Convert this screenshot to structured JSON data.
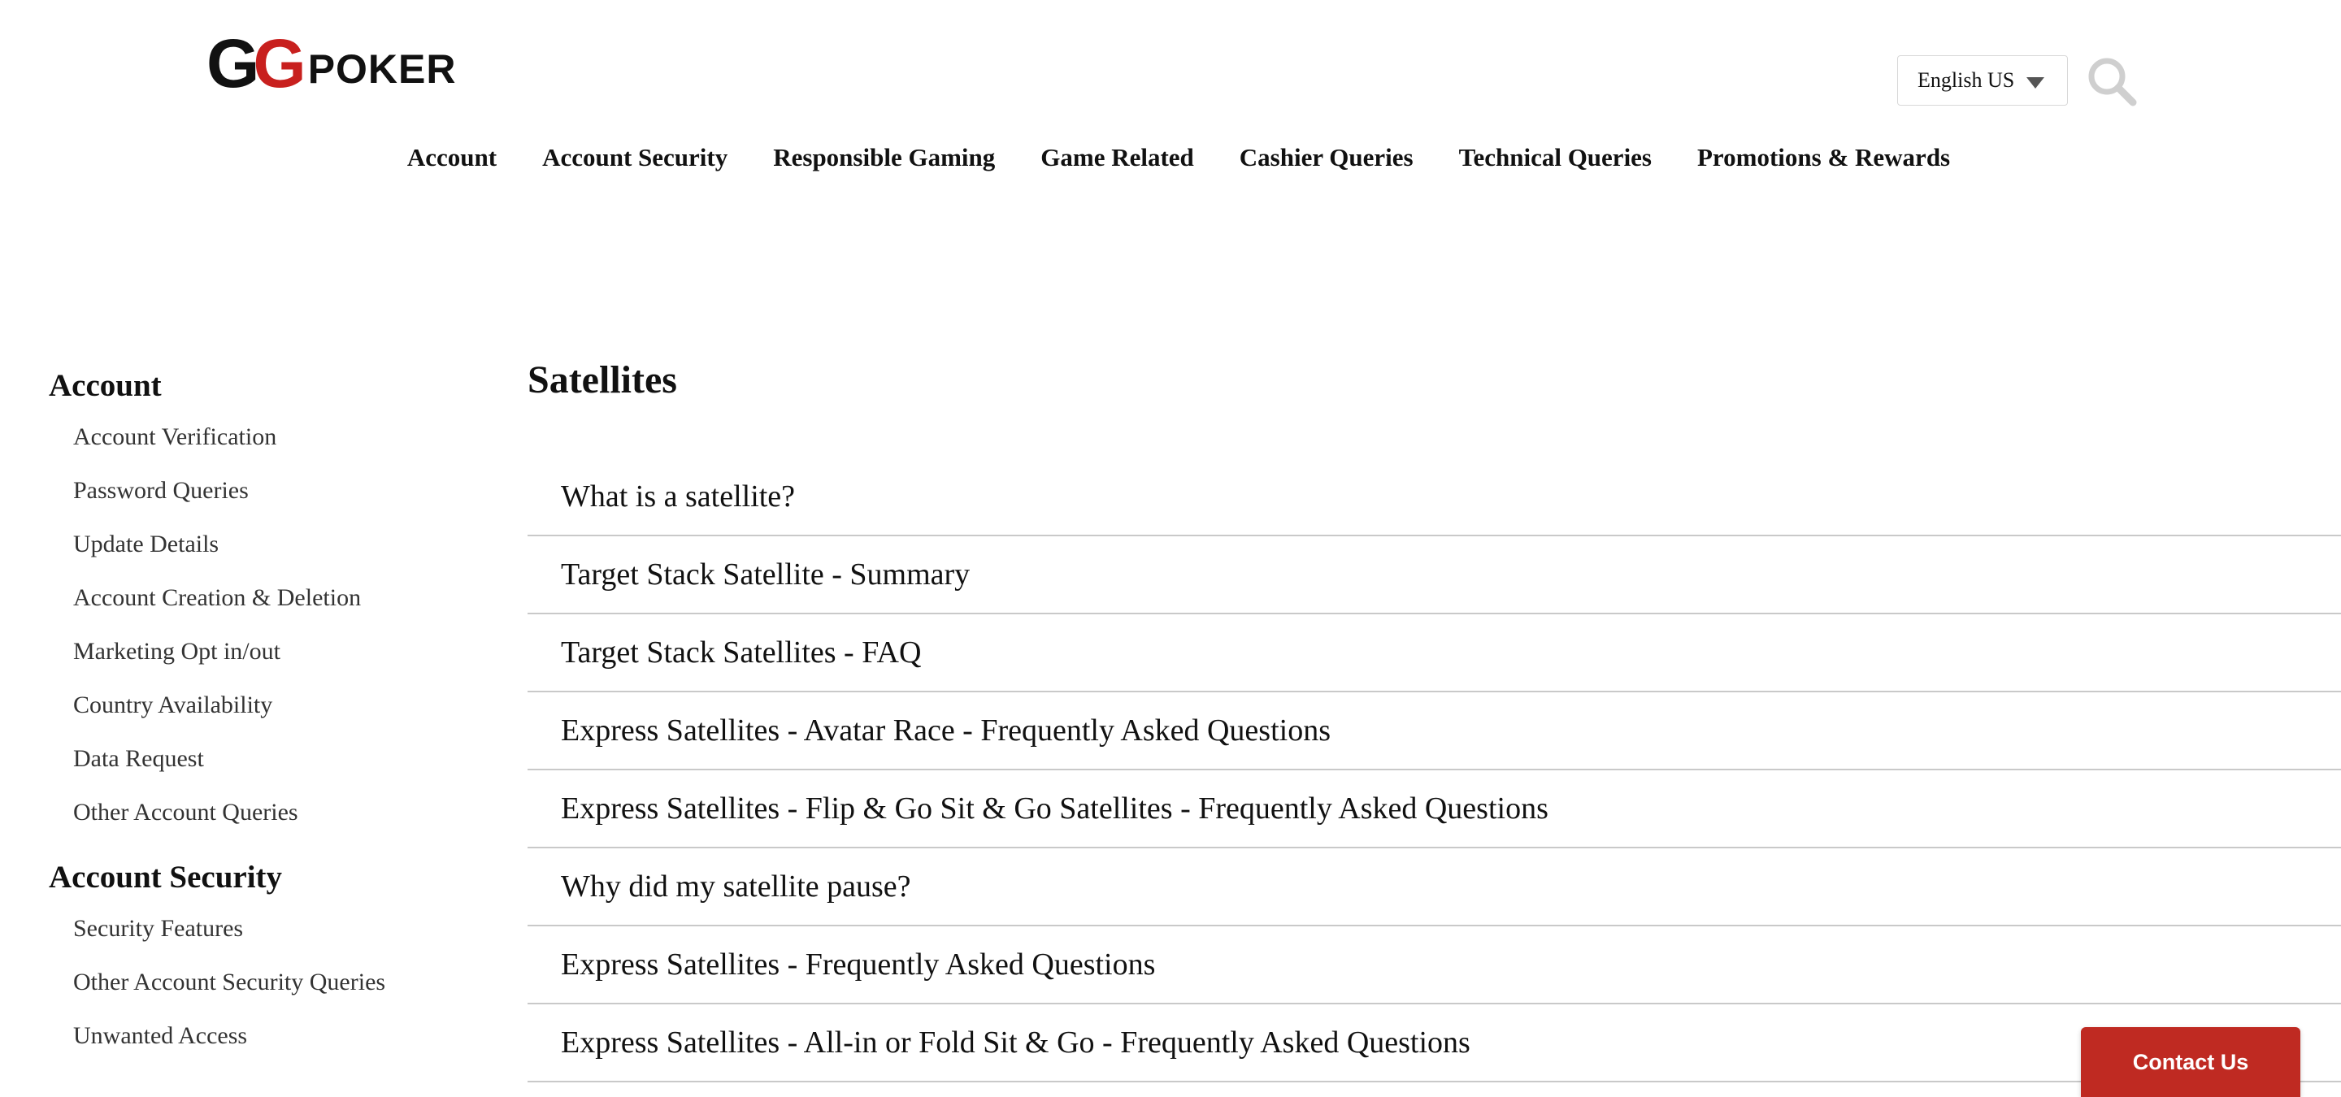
{
  "brand": {
    "logo_gg": "GG",
    "logo_poker": "POKER",
    "accent": "#c8201e"
  },
  "header": {
    "language": "English US",
    "search_icon": "search-icon"
  },
  "topnav": [
    "Account",
    "Account Security",
    "Responsible Gaming",
    "Game Related",
    "Cashier Queries",
    "Technical Queries",
    "Promotions & Rewards"
  ],
  "sidebar": {
    "groups": [
      {
        "title": "Account",
        "items": [
          "Account Verification",
          "Password Queries",
          "Update Details",
          "Account Creation & Deletion",
          "Marketing Opt in/out",
          "Country Availability",
          "Data Request",
          "Other Account Queries"
        ]
      },
      {
        "title": "Account Security",
        "items": [
          "Security Features",
          "Other Account Security Queries",
          "Unwanted Access"
        ]
      }
    ]
  },
  "main": {
    "title": "Satellites",
    "articles": [
      "What is a satellite?",
      "Target Stack Satellite - Summary",
      "Target Stack Satellites - FAQ",
      "Express Satellites - Avatar Race - Frequently Asked Questions",
      "Express Satellites - Flip & Go Sit & Go Satellites - Frequently Asked Questions",
      "Why did my satellite pause?",
      "Express Satellites - Frequently Asked Questions",
      "Express Satellites - All-in or Fold Sit & Go - Frequently Asked Questions"
    ]
  },
  "contact": {
    "label": "Contact Us",
    "color": "#bf2a22"
  }
}
